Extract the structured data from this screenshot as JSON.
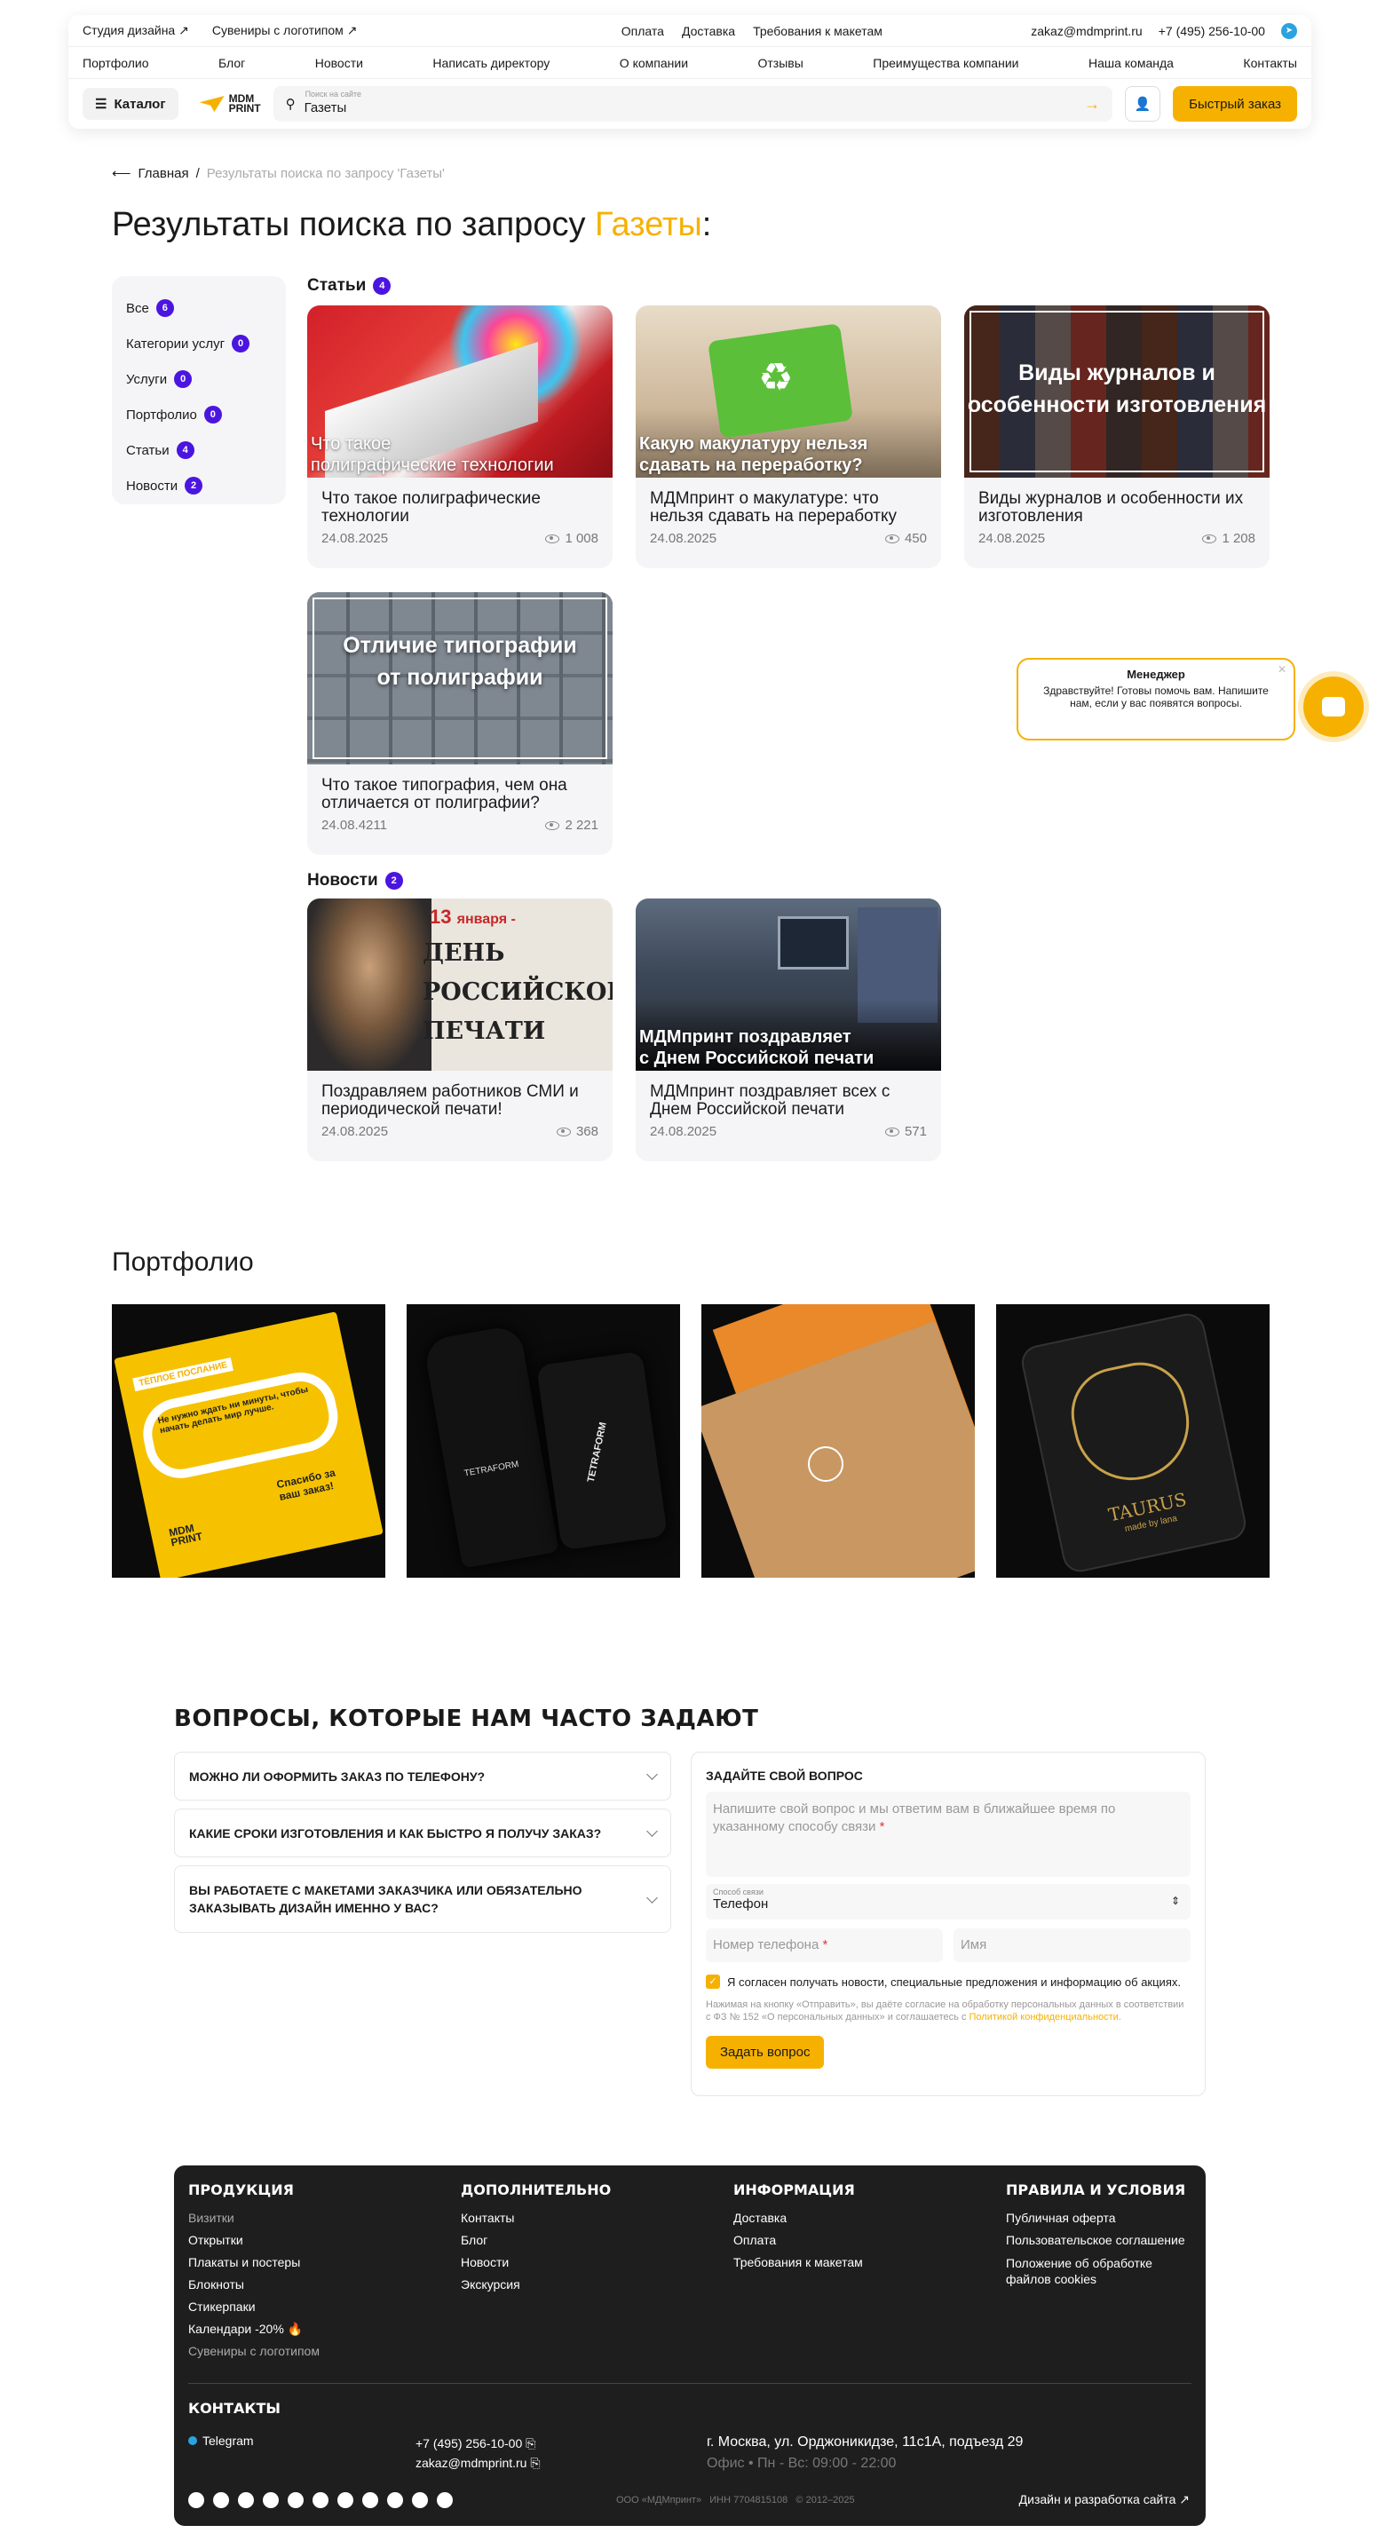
{
  "header": {
    "top_left": [
      "Студия дизайна ↗",
      "Сувениры с логотипом ↗"
    ],
    "top_mid": [
      "Оплата",
      "Доставка",
      "Требования к макетам"
    ],
    "email": "zakaz@mdmprint.ru",
    "phone": "+7 (495) 256-10-00",
    "nav": [
      "Портфолио",
      "Блог",
      "Новости",
      "Написать директору",
      "О компании",
      "Отзывы",
      "Преимущества компании",
      "Наша команда",
      "Контакты"
    ],
    "catalog": "Каталог",
    "logo_line1": "MDM",
    "logo_line2": "PRINT",
    "search_placeholder": "Поиск на сайте",
    "search_value": "Газеты",
    "quick_order": "Быстрый заказ"
  },
  "breadcrumb": {
    "home": "Главная",
    "current": "Результаты поиска по запросу 'Газеты'"
  },
  "title": {
    "prefix": "Результаты поиска по запросу ",
    "query": "Газеты",
    "suffix": ":"
  },
  "filters": [
    {
      "label": "Все",
      "count": "6"
    },
    {
      "label": "Категории услуг",
      "count": "0"
    },
    {
      "label": "Услуги",
      "count": "0"
    },
    {
      "label": "Портфолио",
      "count": "0"
    },
    {
      "label": "Статьи",
      "count": "4"
    },
    {
      "label": "Новости",
      "count": "2"
    }
  ],
  "articles": {
    "heading": "Статьи",
    "count": "4",
    "items": [
      {
        "overlay": "Что такое\nполиграфические технологии",
        "title": "Что такое полиграфические технологии",
        "date": "24.08.2025",
        "views": "1 008"
      },
      {
        "overlay": "Какую макулатуру нельзя\nсдавать на переработку?",
        "title": "МДМпринт о макулатуре: что нельзя сдавать на переработку",
        "date": "24.08.2025",
        "views": "450"
      },
      {
        "overlay": "Виды журналов и\nособенности изготовления",
        "title": "Виды журналов и особенности их изготовления",
        "date": "24.08.2025",
        "views": "1 208"
      },
      {
        "overlay": "Отличие типографии\nот полиграфии",
        "title": "Что такое типография, чем она отличается от полиграфии?",
        "date": "24.08.4211",
        "views": "2 221"
      }
    ]
  },
  "news": {
    "heading": "Новости",
    "count": "2",
    "items": [
      {
        "overlay": "",
        "title": "Поздравляем работников СМИ и периодической печати!",
        "date": "24.08.2025",
        "views": "368"
      },
      {
        "overlay": "МДМпринт поздравляет\nс Днем Российской печати",
        "title": "МДМпринт поздравляет всех с Днем Российской печати",
        "date": "24.08.2025",
        "views": "571"
      }
    ]
  },
  "news_poster": {
    "day": "13",
    "month": "января -",
    "line1": "ДЕНЬ",
    "line2": "РОССИЙСКОЙ",
    "line3": "ПЕЧАТИ"
  },
  "chat": {
    "who": "Менеджер",
    "text": "Здравствуйте! Готовы помочь вам. Напишите нам, если у вас появятся вопросы."
  },
  "portfolio": {
    "title": "Портфолио",
    "poster_tag": "ТЁПЛОЕ ПОСЛАНИЕ",
    "poster_text": "Не нужно ждать ни минуты, чтобы начать делать мир лучше.",
    "poster_thanks": "Спасибо за ваш заказ!",
    "brand": "TETRAFORM",
    "card_name": "TAURUS",
    "card_sub": "made by lana"
  },
  "faq": {
    "title": "ВОПРОСЫ, КОТОРЫЕ НАМ ЧАСТО ЗАДАЮТ",
    "items": [
      "МОЖНО ЛИ ОФОРМИТЬ ЗАКАЗ ПО ТЕЛЕФОНУ?",
      "КАКИЕ СРОКИ ИЗГОТОВЛЕНИЯ И КАК БЫСТРО Я ПОЛУЧУ ЗАКАЗ?",
      "ВЫ РАБОТАЕТЕ С МАКЕТАМИ ЗАКАЗЧИКА ИЛИ ОБЯЗАТЕЛЬНО ЗАКАЗЫВАТЬ ДИЗАЙН ИМЕННО У ВАС?"
    ]
  },
  "ask": {
    "title": "ЗАДАЙТЕ СВОЙ ВОПРОС",
    "textarea_placeholder": "Напишите свой вопрос и мы ответим вам в ближайшее время по указанному способу связи",
    "method_label": "Способ связи",
    "method_value": "Телефон",
    "phone_placeholder": "Номер телефона",
    "name_placeholder": "Имя",
    "consent": "Я согласен получать новости, специальные предложения и информацию об акциях.",
    "legal": "Нажимая на кнопку «Отправить», вы даёте согласие на обработку персональных данных в соответствии с ФЗ № 152 «О персональных данных» и соглашаетесь с ",
    "legal_link": "Политикой конфиденциальности.",
    "submit": "Задать вопрос"
  },
  "footer": {
    "cols": [
      {
        "h": "ПРОДУКЦИЯ",
        "items": [
          "Визитки",
          "Открытки",
          "Плакаты и постеры",
          "Блокноты",
          "Стикерпаки",
          "Календари -20% 🔥",
          "Сувениры с логотипом"
        ]
      },
      {
        "h": "ДОПОЛНИТЕЛЬНО",
        "items": [
          "Контакты",
          "Блог",
          "Новости",
          "Экскурсия"
        ]
      },
      {
        "h": "ИНФОРМАЦИЯ",
        "items": [
          "Доставка",
          "Оплата",
          "Требования к макетам"
        ]
      },
      {
        "h": "ПРАВИЛА И УСЛОВИЯ",
        "items": [
          "Публичная оферта",
          "Пользовательское соглашение",
          "Положение об обработке файлов cookies"
        ]
      }
    ],
    "contacts": "КОНТАКТЫ",
    "telegram": "Telegram",
    "phone": "+7 (495) 256-10-00 ⎘",
    "email": "zakaz@mdmprint.ru ⎘",
    "address": "г. Москва, ул. Орджоникидзе, 11с1А, подъезд 29",
    "hours": "Офис • Пн - Вс: 09:00 - 22:00",
    "legal": "ООО «МДМпринт»   ИНН 7704815108   © 2012–2025",
    "made": "Дизайн и разработка сайта ↗"
  }
}
